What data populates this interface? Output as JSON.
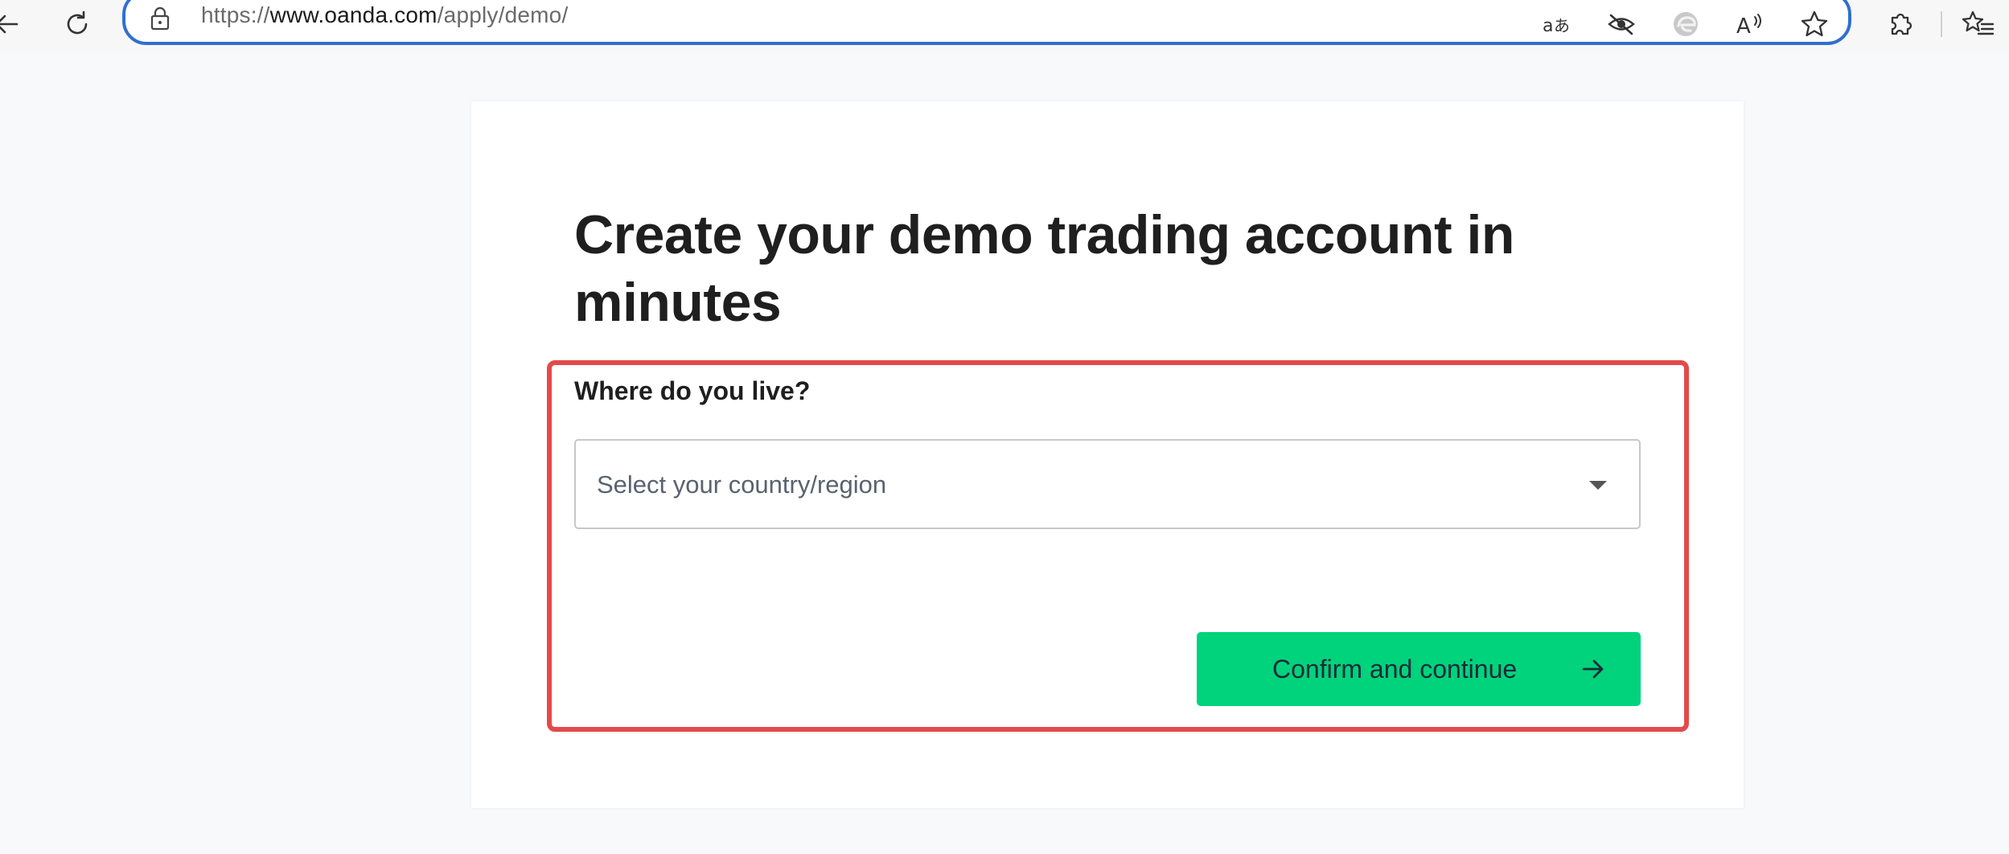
{
  "browser": {
    "url_scheme": "https://",
    "url_host": "www.oanda.com",
    "url_path": "/apply/demo/",
    "icons": [
      "back-arrow-icon",
      "refresh-icon",
      "lock-icon",
      "translate-icon",
      "tracking-prevention-icon",
      "edge-icon",
      "read-aloud-icon",
      "favorite-star-icon",
      "extensions-icon",
      "favorites-list-icon"
    ]
  },
  "page": {
    "title": "Create your demo trading account in minutes",
    "question_label": "Where do you live?",
    "country_select": {
      "placeholder": "Select your country/region"
    },
    "confirm_button_label": "Confirm and continue"
  },
  "colors": {
    "accent_button": "#00d37c",
    "highlight_border": "#e34a4a",
    "address_bar_border": "#2f6fd1"
  }
}
